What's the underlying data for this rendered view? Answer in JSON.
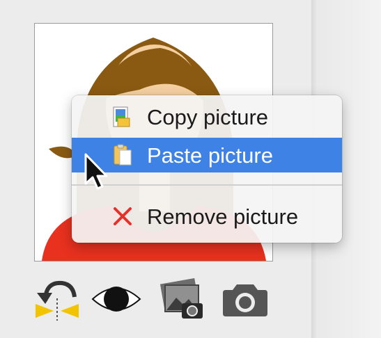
{
  "context_menu": {
    "items": [
      {
        "label": "Copy picture",
        "icon": "copy-picture-icon"
      },
      {
        "label": "Paste picture",
        "icon": "paste-picture-icon",
        "highlighted": true
      },
      {
        "label": "Remove picture",
        "icon": "remove-x-icon"
      }
    ]
  },
  "toolbar": {
    "icons": [
      "flip-rotate-icon",
      "eye-icon",
      "photo-library-icon",
      "camera-icon"
    ]
  },
  "colors": {
    "highlight": "#3f82e6",
    "remove_x": "#e8302a",
    "hair": "#8a5a12",
    "shirt": "#e8311f",
    "skin": "#f4cfa0"
  }
}
